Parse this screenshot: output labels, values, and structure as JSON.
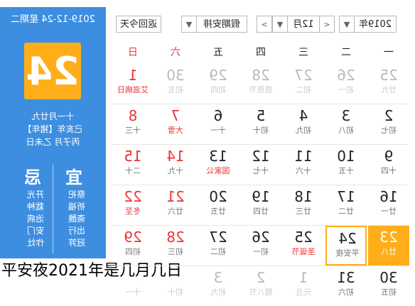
{
  "left_panel": {
    "date_line": "2019-12-24 星期二",
    "big_day": "24",
    "lunar_line1": "十一月廿九",
    "lunar_line2": "己亥年【猪年】",
    "lunar_line3": "丙子月 乙未日",
    "yi_label": "宜",
    "ji_label": "忌",
    "yi_items": [
      "祭祀",
      "祈福",
      "斋醮",
      "出行",
      "冠笄"
    ],
    "ji_items": [
      "开光",
      "栽种",
      "治病",
      "安门",
      "作灶"
    ]
  },
  "toolbar": {
    "today_button": "返回今天",
    "holiday_select": "假期安排",
    "month_select": "12月",
    "year_select": "2019年",
    "prev_label": "<",
    "next_label": ">",
    "dropdown_label": "▼"
  },
  "weekdays": [
    "一",
    "二",
    "三",
    "四",
    "五",
    "六",
    "日"
  ],
  "weeks": [
    [
      {
        "n": "25",
        "s": "廿九",
        "c": "other"
      },
      {
        "n": "26",
        "s": "初一",
        "c": "other"
      },
      {
        "n": "27",
        "s": "初二",
        "c": "other"
      },
      {
        "n": "28",
        "s": "感恩节",
        "c": "other"
      },
      {
        "n": "29",
        "s": "初四",
        "c": "other"
      },
      {
        "n": "30",
        "s": "初五",
        "c": "other wkend"
      },
      {
        "n": "1",
        "s": "艾滋病日",
        "c": "wkend fest"
      }
    ],
    [
      {
        "n": "2",
        "s": "初七",
        "c": ""
      },
      {
        "n": "3",
        "s": "初八",
        "c": ""
      },
      {
        "n": "4",
        "s": "初九",
        "c": ""
      },
      {
        "n": "5",
        "s": "初十",
        "c": ""
      },
      {
        "n": "6",
        "s": "十一",
        "c": ""
      },
      {
        "n": "7",
        "s": "大雪",
        "c": "wkend fest"
      },
      {
        "n": "8",
        "s": "十三",
        "c": "wkend"
      }
    ],
    [
      {
        "n": "9",
        "s": "十四",
        "c": ""
      },
      {
        "n": "10",
        "s": "十五",
        "c": ""
      },
      {
        "n": "11",
        "s": "十六",
        "c": ""
      },
      {
        "n": "12",
        "s": "十七",
        "c": ""
      },
      {
        "n": "13",
        "s": "国家公",
        "c": "fest"
      },
      {
        "n": "14",
        "s": "十九",
        "c": "wkend"
      },
      {
        "n": "15",
        "s": "二十",
        "c": "wkend"
      }
    ],
    [
      {
        "n": "16",
        "s": "廿一",
        "c": ""
      },
      {
        "n": "17",
        "s": "廿二",
        "c": ""
      },
      {
        "n": "18",
        "s": "廿三",
        "c": ""
      },
      {
        "n": "19",
        "s": "廿四",
        "c": ""
      },
      {
        "n": "20",
        "s": "廿五",
        "c": ""
      },
      {
        "n": "21",
        "s": "廿六",
        "c": "wkend"
      },
      {
        "n": "22",
        "s": "冬至",
        "c": "wkend fest"
      }
    ],
    [
      {
        "n": "23",
        "s": "廿八",
        "c": "sel"
      },
      {
        "n": "24",
        "s": "平安夜",
        "c": "hi"
      },
      {
        "n": "25",
        "s": "圣诞节",
        "c": "fest"
      },
      {
        "n": "26",
        "s": "初一",
        "c": ""
      },
      {
        "n": "27",
        "s": "初二",
        "c": ""
      },
      {
        "n": "28",
        "s": "初三",
        "c": "wkend"
      },
      {
        "n": "29",
        "s": "初四",
        "c": "wkend"
      }
    ],
    [
      {
        "n": "30",
        "s": "初五",
        "c": ""
      },
      {
        "n": "31",
        "s": "初六",
        "c": ""
      },
      {
        "n": "1",
        "s": "元旦",
        "c": "other"
      },
      {
        "n": "2",
        "s": "腊八节",
        "c": "other"
      },
      {
        "n": "3",
        "s": "初九",
        "c": "other"
      },
      {
        "n": "4",
        "s": "初十",
        "c": "other wkend"
      },
      {
        "n": "5",
        "s": "十一",
        "c": "other wkend"
      }
    ]
  ],
  "caption": "平安夜2021年是几月几日"
}
